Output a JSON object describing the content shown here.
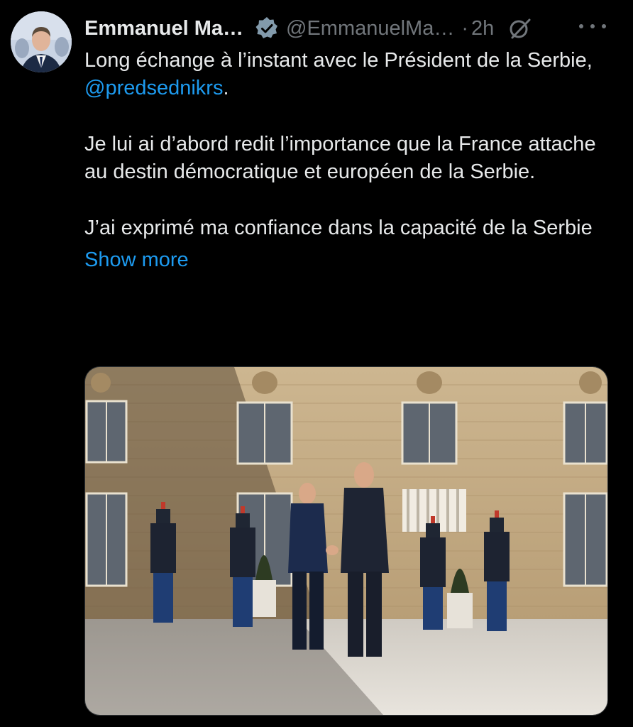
{
  "author": {
    "display_name": "Emmanuel Ma…",
    "handle": "@EmmanuelMa…",
    "separator": "·",
    "time_ago": "2h",
    "verified_icon": "verified-badge-icon",
    "verified_color": "#829aab",
    "grok_icon": "grok-icon",
    "more_icon": "more-options-icon"
  },
  "post": {
    "line1_prefix": "Long échange à l’instant avec le Président de la Serbie, ",
    "mention": "@predsednikrs",
    "line1_suffix": ".",
    "paragraph2": "Je lui ai d’abord redit l’importance que la France attache au destin démocratique et européen de la Serbie.",
    "paragraph3": "J’ai exprimé ma confiance dans la capacité de la Serbie",
    "show_more": "Show more"
  },
  "media": {
    "type": "photo"
  },
  "colors": {
    "background": "#000000",
    "text": "#e7e9ea",
    "secondary": "#71767b",
    "link": "#1d9bf0"
  }
}
